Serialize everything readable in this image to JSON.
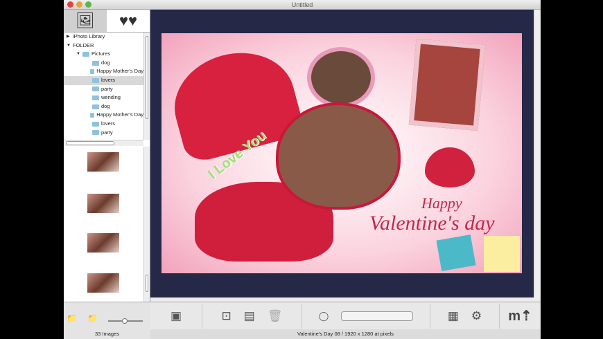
{
  "window": {
    "title": "Untitled"
  },
  "sidebar": {
    "tabs": [
      {
        "name": "photos",
        "icon": "photo-icon"
      },
      {
        "name": "templates",
        "icon": "hearts-icon"
      }
    ],
    "tree": [
      {
        "label": "iPhoto Library",
        "level": 0
      },
      {
        "label": "FOLDER",
        "level": 0
      },
      {
        "label": "Pictures",
        "level": 1
      },
      {
        "label": "dog",
        "level": 2
      },
      {
        "label": "Happy Mother's Day",
        "level": 2
      },
      {
        "label": "lovers",
        "level": 2,
        "selected": true
      },
      {
        "label": "party",
        "level": 2
      },
      {
        "label": "wending",
        "level": 2
      },
      {
        "label": "dog",
        "level": 2
      },
      {
        "label": "Happy Mother's Day",
        "level": 2
      },
      {
        "label": "lovers",
        "level": 2
      },
      {
        "label": "party",
        "level": 2
      }
    ],
    "image_count": "33 Images"
  },
  "canvas": {
    "text1": "I Love You",
    "text2": "Happy",
    "text3": "Valentine's day"
  },
  "status": "Valentine's Day 08 / 1920 x 1280 at pixels",
  "colors": {
    "accent": "#d0223e",
    "canvas_bg": "#262848"
  }
}
